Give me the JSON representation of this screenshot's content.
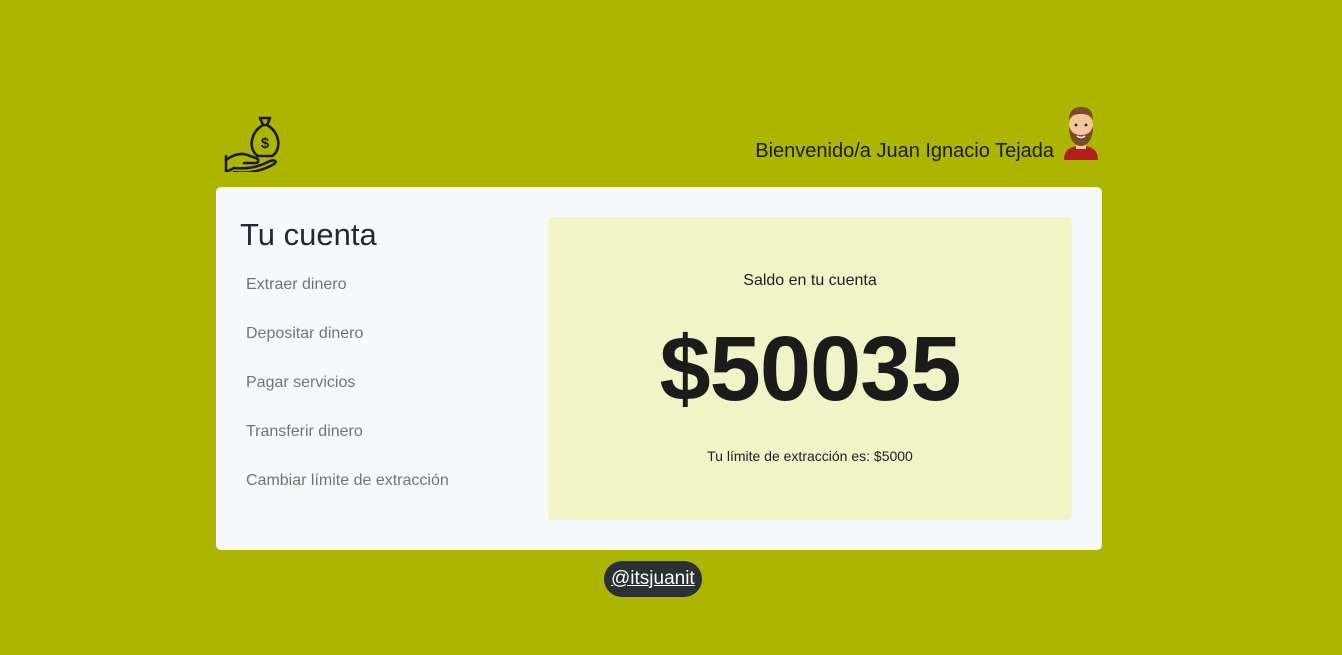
{
  "header": {
    "logo_icon": "hand-money-bag-icon",
    "welcome_text": "Bienvenido/a Juan Ignacio Tejada",
    "avatar_icon": "man-avatar-icon"
  },
  "account": {
    "title": "Tu cuenta",
    "menu": [
      {
        "label": "Extraer dinero"
      },
      {
        "label": "Depositar dinero"
      },
      {
        "label": "Pagar servicios"
      },
      {
        "label": "Transferir dinero"
      },
      {
        "label": "Cambiar límite de extracción"
      }
    ],
    "balance_label": "Saldo en tu cuenta",
    "balance_amount": "$50035",
    "limit_text": "Tu límite de extracción es: $5000"
  },
  "footer": {
    "handle": "@itsjuanit"
  },
  "colors": {
    "background": "#acb500",
    "card": "#f8f9fa",
    "balance_box": "#f0f4c6",
    "footer_badge": "#2b3035"
  }
}
